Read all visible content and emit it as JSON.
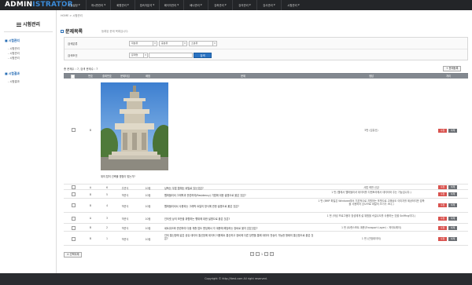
{
  "app": {
    "logo_main": "ADMIN",
    "logo_accent": "ISTRATOR"
  },
  "nav": [
    {
      "label": "기본설정"
    },
    {
      "label": "게시판관리"
    },
    {
      "label": "회원관리"
    },
    {
      "label": "접속자분석"
    },
    {
      "label": "페이지관리"
    },
    {
      "label": "배너관리"
    },
    {
      "label": "강좌관리"
    },
    {
      "label": "강의관리"
    },
    {
      "label": "강사관리"
    },
    {
      "label": "시험관리"
    }
  ],
  "breadcrumb": "HOME > 시험관리",
  "sidebar": {
    "title": "시험관리",
    "groups": [
      {
        "label": "시험관리",
        "items": [
          "시험관리",
          "시험관리",
          "시험관리"
        ]
      },
      {
        "label": "시험결과",
        "items": [
          "시험결과"
        ]
      }
    ]
  },
  "page": {
    "title": "문제목록",
    "desc": "등록된 문제 목록입니다."
  },
  "search": {
    "row1_label": "검색분류",
    "row2_label": "검색조건",
    "sel1": "대분류",
    "sel2": "중분류",
    "sel3": "소분류",
    "sel4": "문제명",
    "button": "검색"
  },
  "count_text": "총 문제수 : 7, 검색 문제수 : 7",
  "register_btn": "+ 문제등록",
  "table": {
    "headers": [
      "번호",
      "출제번호",
      "문제타입",
      "배점",
      "문제",
      "정답",
      "처리"
    ],
    "rows": [
      {
        "lvl": "B",
        "num": "7",
        "type": "객관식",
        "score": "10점",
        "q": "위의 탑의 건축물 명칭이 맞는가?",
        "a": "5번 (김유신)"
      },
      {
        "lvl": "A",
        "num": "6",
        "type": "주관식",
        "score": "10점",
        "q": "낭독는 우탑 탑에는 비밀로 있는것은?",
        "a": "사탑 죄판 신강"
      },
      {
        "lvl": "B",
        "num": "5",
        "type": "객관식",
        "score": "10점",
        "q": "웹퍼블리셔 그래픽과 관련하여(Residency) 기법에 대한 설명으로 옳은 것은?",
        "a": "1 번 (웹에서 웹퍼블리셔 데이터를 디렌토리에서 데이터와 주는 기능입니다.)"
      },
      {
        "lvl": "B",
        "num": "4",
        "type": "객관식",
        "score": "10점",
        "q": "웹퍼블리셔서 사용되는 그래픽 요일의 방식에 관한 설명으로 옳은 것은?",
        "a": "1 번 (BMP 파일은 Windows에서 기본적으로 지원하는 포맷으로 고해상도 이미지를 제공하지만 압축을 사용하지 않으므로 파일의 크기가 크다.)"
      },
      {
        "lvl": "A",
        "num": "3",
        "type": "객관식",
        "score": "10점",
        "q": "인터넷 상의 보안을 위협하는 행위에 대한 설명으로 옳은 것은?",
        "a": "1 번 (악성 프로그램이 장성에게 설 위험을 속일수도를 사용하는 것을 Sniffing이다.)"
      },
      {
        "lvl": "B",
        "num": "2",
        "type": "객관식",
        "score": "10점",
        "q": "네트워크와 관련하여 다음 게층 업도 앤딩에서 각 계층에 해당하는 장비로 옳지 않은것은?",
        "a": "1 번 (트랜스포트 계층(Transport Layer) : 게이트웨이)"
      },
      {
        "lvl": "B",
        "num": "1",
        "type": "객관식",
        "score": "10점",
        "q": "인터 통신망에 같은 공유 데이터 통신망에 데이터 이용해서 통신하고 장비에 다른 장면을 통해 데이터 전송이 가능한 형태의 통신망으로 옳은 것은?",
        "a": "1 번 (근범데이터)"
      }
    ],
    "edit_label": "수정",
    "delete_label": "삭제"
  },
  "selected_delete": "✕ 선택삭제",
  "pager": {
    "current": "1"
  },
  "footer": "Copyright © http://itest.com All right reserved.",
  "colors": {
    "topbar": "#232528",
    "accent": "#2a73c2",
    "edit": "#d9534f",
    "delete": "#6b6f74"
  }
}
